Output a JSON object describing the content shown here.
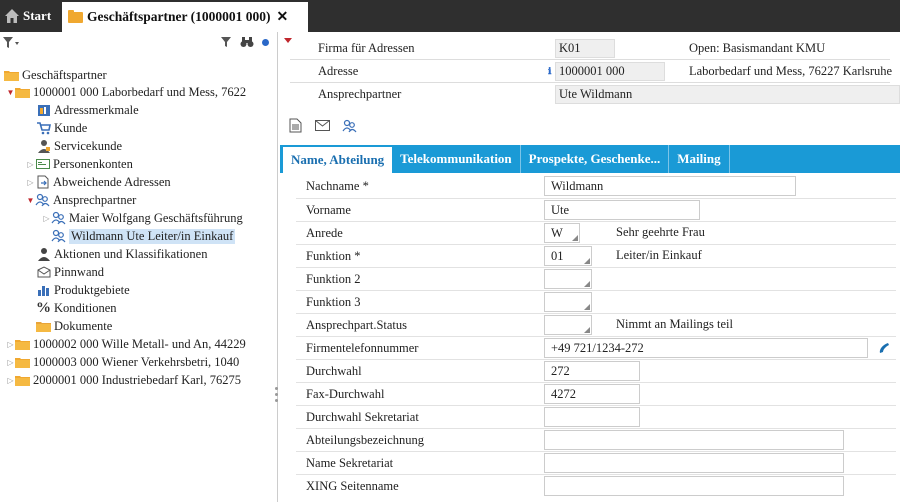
{
  "tabs": {
    "start_label": "Start",
    "active_label": "Geschäftspartner (1000001 000)",
    "close_glyph": "✕"
  },
  "tree": {
    "root": "Geschäftspartner",
    "items": [
      {
        "label": "1000001  000  Laborbedarf und Mess, 7622",
        "icon": "folder-icon"
      },
      {
        "label": "Adressmerkmale",
        "icon": "address-features-icon"
      },
      {
        "label": "Kunde",
        "icon": "cart-icon"
      },
      {
        "label": "Servicekunde",
        "icon": "service-person-icon"
      },
      {
        "label": "Personenkonten",
        "icon": "account-card-icon"
      },
      {
        "label": "Abweichende Adressen",
        "icon": "document-arrow-icon"
      },
      {
        "label": "Ansprechpartner",
        "icon": "contacts-icon"
      },
      {
        "label": "Maier  Wolfgang  Geschäftsführung",
        "icon": "contact-person-icon"
      },
      {
        "label": "Wildmann  Ute  Leiter/in Einkauf",
        "icon": "contact-person-icon"
      },
      {
        "label": "Aktionen und Klassifikationen",
        "icon": "person-icon"
      },
      {
        "label": "Pinnwand",
        "icon": "envelope-icon"
      },
      {
        "label": "Produktgebiete",
        "icon": "bar-chart-icon"
      },
      {
        "label": "Konditionen",
        "icon": "percent-icon"
      },
      {
        "label": "Dokumente",
        "icon": "folder-icon"
      },
      {
        "label": "1000002  000  Wille Metall- und An, 44229",
        "icon": "folder-icon"
      },
      {
        "label": "1000003  000  Wiener Verkehrsbetri, 1040",
        "icon": "folder-icon"
      },
      {
        "label": "2000001  000  Industriebedarf Karl, 76275",
        "icon": "folder-icon"
      }
    ]
  },
  "header": {
    "firma_label": "Firma für Adressen",
    "firma_value": "K01",
    "firma_extra": "Open: Basismandant KMU",
    "adresse_label": "Adresse",
    "adresse_value": "1000001 000",
    "adresse_extra": "Laborbedarf und Mess, 76227 Karlsruhe",
    "ansprech_label": "Ansprechpartner",
    "ansprech_value": "Ute Wildmann"
  },
  "subtabs": [
    "Name, Abteilung",
    "Telekommunikation",
    "Prospekte, Geschenke...",
    "Mailing"
  ],
  "form": {
    "nachname_label": "Nachname *",
    "nachname_value": "Wildmann",
    "vorname_label": "Vorname",
    "vorname_value": "Ute",
    "anrede_label": "Anrede",
    "anrede_value": "W",
    "anrede_desc": "Sehr geehrte Frau",
    "funktion_label": "Funktion *",
    "funktion_value": "01",
    "funktion_desc": "Leiter/in Einkauf",
    "funktion2_label": "Funktion 2",
    "funktion2_value": "",
    "funktion3_label": "Funktion 3",
    "funktion3_value": "",
    "status_label": "Ansprechpart.Status",
    "status_value": "",
    "status_desc": "Nimmt an Mailings teil",
    "firmentel_label": "Firmentelefonnummer",
    "firmentel_value": "+49 721/1234-272",
    "durchwahl_label": "Durchwahl",
    "durchwahl_value": "272",
    "fax_label": "Fax-Durchwahl",
    "fax_value": "4272",
    "sekdw_label": "Durchwahl Sekretariat",
    "sekdw_value": "",
    "abteilung_label": "Abteilungsbezeichnung",
    "abteilung_value": "",
    "seknam_label": "Name Sekretariat",
    "seknam_value": "",
    "xing_label": "XING Seitenname",
    "xing_value": ""
  },
  "colors": {
    "accent": "#1a9ad6",
    "tabbar": "#2f2f2f",
    "folder": "#f0a830",
    "expand": "#c0272d"
  }
}
